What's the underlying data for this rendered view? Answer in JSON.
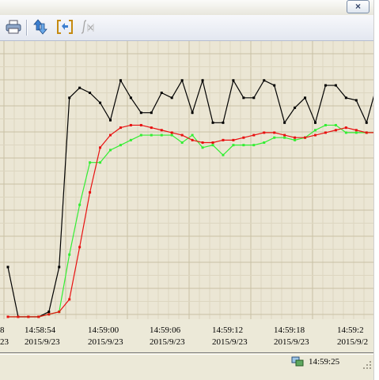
{
  "window": {
    "close_label": "×"
  },
  "toolbar": {
    "buttons": [
      {
        "name": "print",
        "icon": "print-icon"
      },
      {
        "name": "move-cursor",
        "icon": "vertical-arrows-icon"
      },
      {
        "name": "fit-range",
        "icon": "bracket-fit-icon"
      },
      {
        "name": "formula",
        "icon": "integral-icon"
      }
    ]
  },
  "chart_data": {
    "type": "line",
    "x_tick_labels": [
      {
        "time": "8",
        "date": "23"
      },
      {
        "time": "14:58:54",
        "date": "2015/9/23"
      },
      {
        "time": "14:59:00",
        "date": "2015/9/23"
      },
      {
        "time": "14:59:06",
        "date": "2015/9/23"
      },
      {
        "time": "14:59:12",
        "date": "2015/9/23"
      },
      {
        "time": "14:59:18",
        "date": "2015/9/23"
      },
      {
        "time": "14:59:2",
        "date": "2015/9/2"
      }
    ],
    "grid": true,
    "colors": {
      "black": "#000000",
      "green": "#33ee33",
      "red": "#e81010",
      "grid": "#cfc8b0"
    },
    "series": [
      {
        "color": "black",
        "values": [
          20,
          0,
          0,
          0,
          2,
          20,
          88,
          92,
          90,
          86,
          79,
          95,
          88,
          82,
          82,
          90,
          88,
          95,
          82,
          95,
          78,
          78,
          95,
          88,
          88,
          95,
          93,
          78,
          84,
          88,
          78,
          93,
          93,
          88,
          87,
          78,
          93
        ]
      },
      {
        "color": "green",
        "values": [
          0,
          0,
          0,
          0,
          1,
          2,
          25,
          45,
          62,
          62,
          67,
          69,
          71,
          73,
          73,
          73,
          73,
          70,
          73,
          68,
          69,
          65,
          69,
          69,
          69,
          70,
          72,
          72,
          71,
          72,
          75,
          77,
          77,
          74,
          74,
          74,
          74
        ]
      },
      {
        "color": "red",
        "values": [
          0,
          0,
          0,
          0,
          1,
          2,
          7,
          28,
          50,
          68,
          73,
          76,
          77,
          77,
          76,
          75,
          74,
          73,
          71,
          70,
          70,
          71,
          71,
          72,
          73,
          74,
          74,
          73,
          72,
          72,
          73,
          74,
          75,
          76,
          75,
          74,
          74
        ]
      }
    ]
  },
  "status": {
    "time": "14:59:25",
    "icon": "network-icon"
  }
}
